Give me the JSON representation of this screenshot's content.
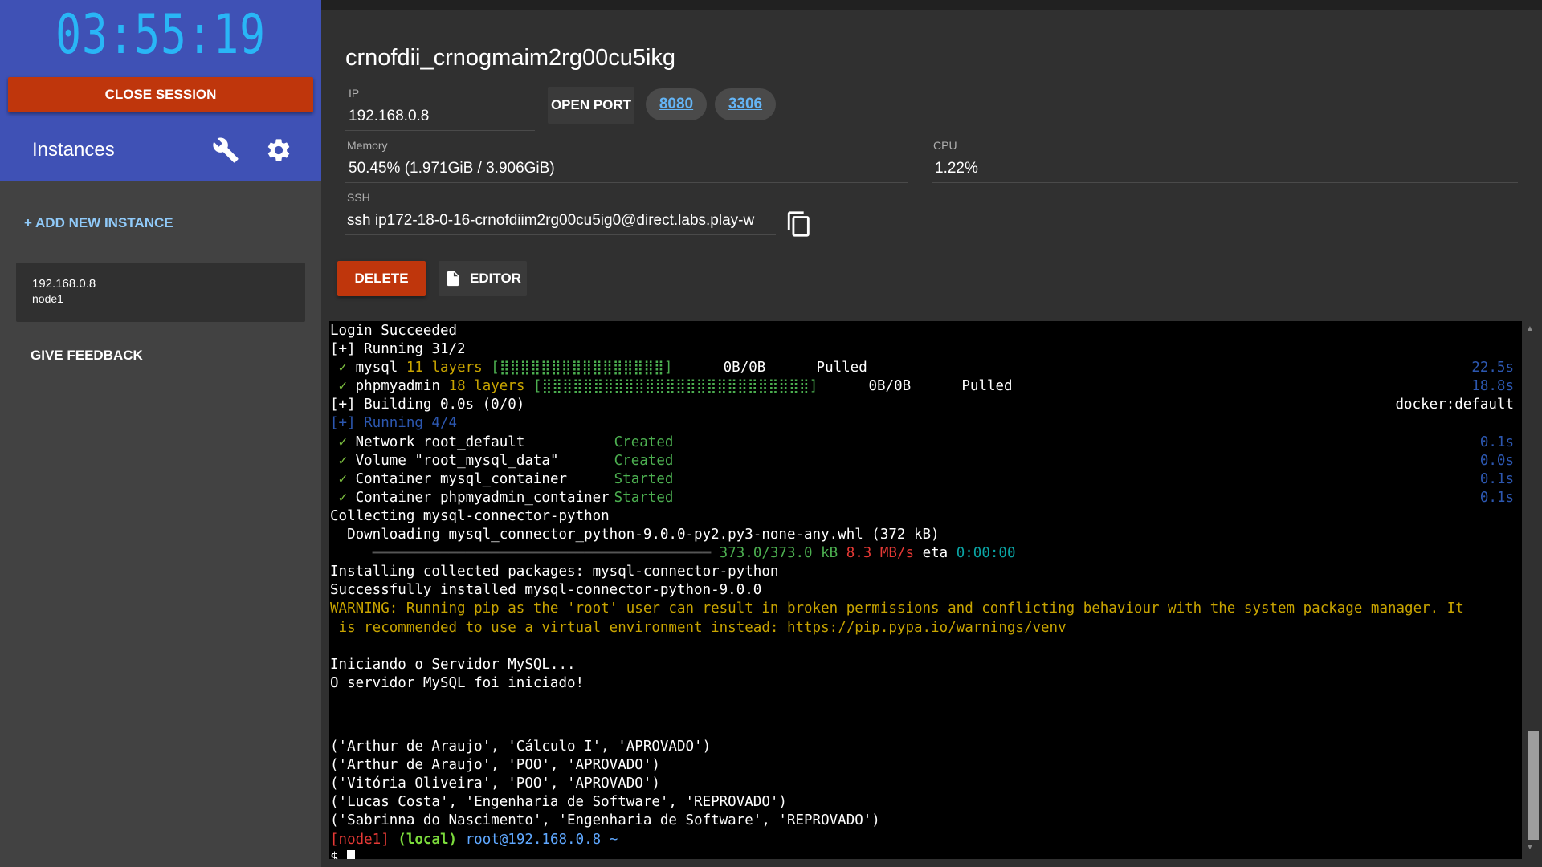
{
  "sidebar": {
    "timer": "03:55:19",
    "close_session": "CLOSE SESSION",
    "instances_title": "Instances",
    "add_instance": "+ ADD NEW INSTANCE",
    "instance": {
      "ip": "192.168.0.8",
      "name": "node1"
    },
    "give_feedback": "GIVE FEEDBACK"
  },
  "instance_panel": {
    "title": "crnofdii_crnogmaim2rg00cu5ikg",
    "ip_label": "IP",
    "ip_value": "192.168.0.8",
    "open_port": "OPEN PORT",
    "ports": [
      "8080",
      "3306"
    ],
    "memory_label": "Memory",
    "memory_value": "50.45% (1.971GiB / 3.906GiB)",
    "cpu_label": "CPU",
    "cpu_value": "1.22%",
    "ssh_label": "SSH",
    "ssh_value": "ssh ip172-18-0-16-crnofdiim2rg00cu5ig0@direct.labs.play-w",
    "delete": "DELETE",
    "editor": "EDITOR"
  },
  "terminal": {
    "l1": "Login Succeeded",
    "l2": "[+] Running 31/2",
    "mysql_name": "mysql",
    "mysql_layers": "11 layers",
    "mysql_bar": "[⣿⣿⣿⣿⣿⣿⣿⣿⣿⣿⣿⣿⣿⣿⣿⣿]",
    "mysql_size": "0B/0B",
    "mysql_status": "Pulled",
    "mysql_time": "22.5s",
    "pma_name": "phpmyadmin",
    "pma_layers": "18 layers",
    "pma_bar": "[⣿⣿⣿⣿⣿⣿⣿⣿⣿⣿⣿⣿⣿⣿⣿⣿⣿⣿⣿⣿⣿⣿⣿⣿⣿⣿]",
    "pma_size": "0B/0B",
    "pma_status": "Pulled",
    "pma_time": "18.8s",
    "building": "[+] Building 0.0s (0/0)",
    "building_right": "docker:default",
    "running44": "[+] Running 4/4",
    "r1_name": "Network root_default",
    "r1_status": "Created",
    "r1_time": "0.1s",
    "r2_name": "Volume \"root_mysql_data\"",
    "r2_status": "Created",
    "r2_time": "0.0s",
    "r3_name": "Container mysql_container",
    "r3_status": "Started",
    "r3_time": "0.1s",
    "r4_name": "Container phpmyadmin_container",
    "r4_status": "Started",
    "r4_time": "0.1s",
    "check": "✓",
    "collecting": "Collecting mysql-connector-python",
    "downloading": "  Downloading mysql_connector_python-9.0.0-py2.py3-none-any.whl (372 kB)",
    "progress_bar": "     ━━━━━━━━━━━━━━━━━━━━━━━━━━━━━━━━━━━━━━━━",
    "progress_size": "373.0/373.0 kB",
    "progress_speed": "8.3 MB/s",
    "progress_eta_label": "eta",
    "progress_eta": "0:00:00",
    "installing": "Installing collected packages: mysql-connector-python",
    "installed": "Successfully installed mysql-connector-python-9.0.0",
    "warn1": "WARNING: Running pip as the 'root' user can result in broken permissions and conflicting behaviour with the system package manager. It",
    "warn2": " is recommended to use a virtual environment instead: https://pip.pypa.io/warnings/venv",
    "iniciando": "Iniciando o Servidor MySQL...",
    "iniciado": "O servidor MySQL foi iniciado!",
    "rows": [
      "('Arthur de Araujo', 'Cálculo I', 'APROVADO')",
      "('Arthur de Araujo', 'POO', 'APROVADO')",
      "('Vitória Oliveira', 'POO', 'APROVADO')",
      "('Lucas Costa', 'Engenharia de Software', 'REPROVADO')",
      "('Sabrinna do Nascimento', 'Engenharia de Software', 'REPROVADO')"
    ],
    "prompt_node": "[node1]",
    "prompt_local": "(local)",
    "prompt_host": "root@192.168.0.8 ~",
    "prompt_dollar": "$ "
  },
  "colors": {
    "sidebar_header": "#3f51b5",
    "danger": "#bf360c",
    "timer": "#29b6f6",
    "link": "#64b5f6"
  }
}
